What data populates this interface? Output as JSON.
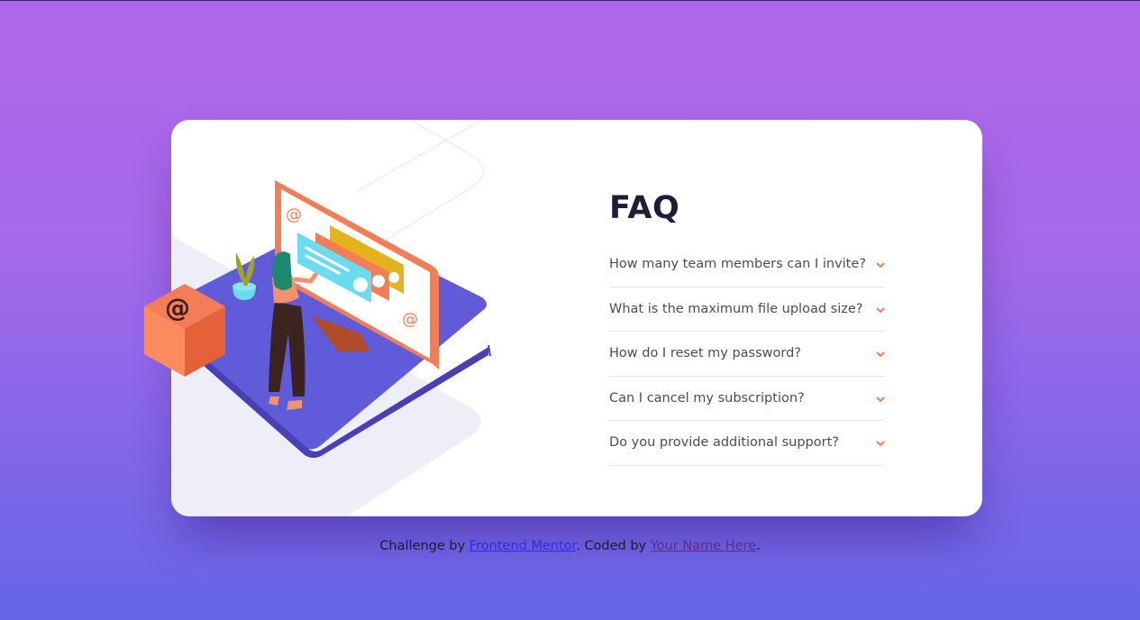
{
  "page": {
    "background_top": "#af67e9",
    "background_bottom": "#6565e7"
  },
  "card": {
    "title": "FAQ",
    "questions": [
      {
        "label": "How many team members can I invite?",
        "expanded": false
      },
      {
        "label": "What is the maximum file upload size?",
        "expanded": false
      },
      {
        "label": "How do I reset my password?",
        "expanded": false
      },
      {
        "label": "Can I cancel my subscription?",
        "expanded": false
      },
      {
        "label": "Do you provide additional support?",
        "expanded": false
      }
    ],
    "accent_color": "#f47c57"
  },
  "illustration": {
    "box_symbol": "@",
    "screen_symbol": "@"
  },
  "footer": {
    "prefix": "Challenge by ",
    "challenge_link": "Frontend Mentor",
    "middle": ". Coded by ",
    "author_link": "Your Name Here",
    "suffix": "."
  }
}
